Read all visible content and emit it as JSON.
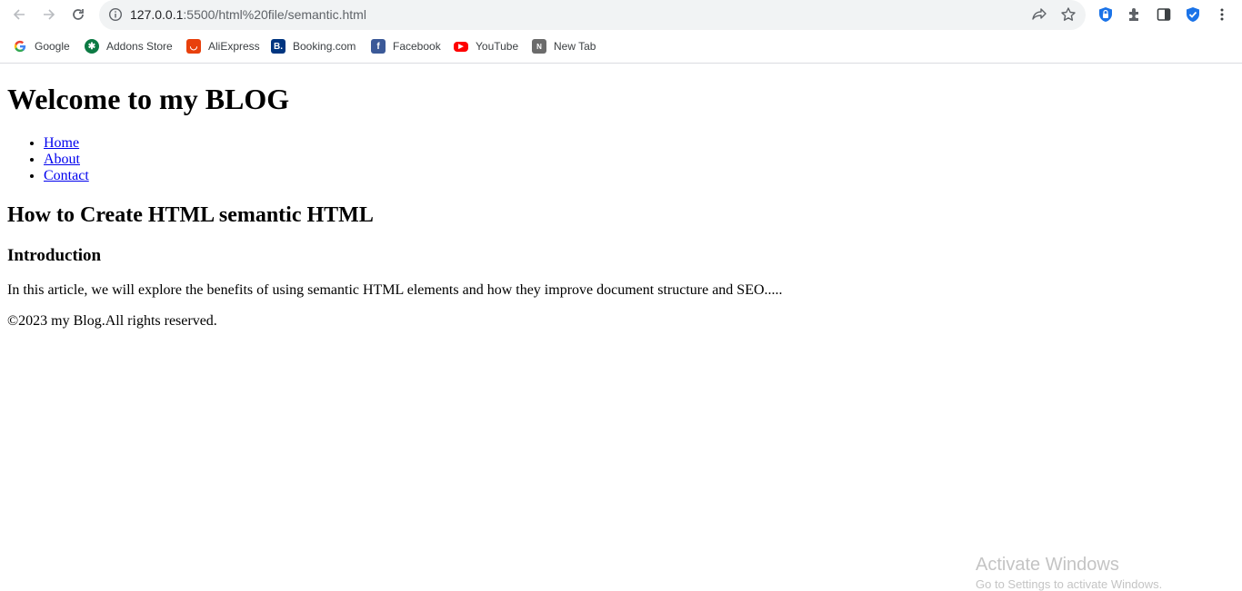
{
  "browser": {
    "url_host": "127.0.0.1",
    "url_rest": ":5500/html%20file/semantic.html"
  },
  "bookmarks": [
    {
      "label": "Google",
      "icon": "google-icon"
    },
    {
      "label": "Addons Store",
      "icon": "addons-store-icon"
    },
    {
      "label": "AliExpress",
      "icon": "aliexpress-icon"
    },
    {
      "label": "Booking.com",
      "icon": "booking-icon"
    },
    {
      "label": "Facebook",
      "icon": "facebook-icon"
    },
    {
      "label": "YouTube",
      "icon": "youtube-icon"
    },
    {
      "label": "New Tab",
      "icon": "new-tab-icon"
    }
  ],
  "page": {
    "title": "Welcome to my BLOG",
    "nav": [
      "Home",
      "About",
      "Contact"
    ],
    "article_title": "How to Create HTML semantic HTML",
    "section_title": "Introduction",
    "body": "In this article, we will explore the benefits of using semantic HTML elements and how they improve document structure and SEO.....",
    "footer": "©2023 my Blog.All rights reserved."
  },
  "watermark": {
    "line1": "Activate Windows",
    "line2": "Go to Settings to activate Windows."
  },
  "colors": {
    "link": "#0000ee",
    "omnibox_bg": "#f1f3f4",
    "extension_blue": "#1a73e8"
  }
}
